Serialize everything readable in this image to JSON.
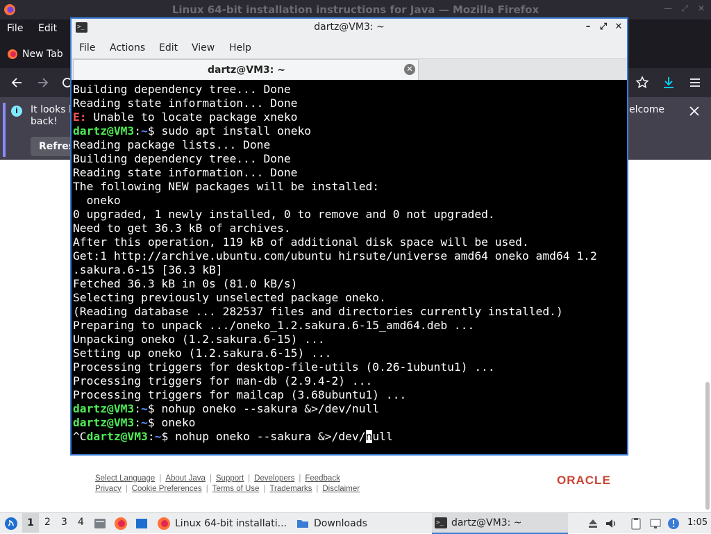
{
  "firefox": {
    "window_title": "Linux 64-bit installation instructions for Java — Mozilla Firefox",
    "menu": [
      "File",
      "Edit"
    ],
    "tab_label": "New Tab",
    "notification": {
      "text_left": "It looks l",
      "text_left2": "back!",
      "text_right": "elcome",
      "button": "Refres"
    }
  },
  "footer": {
    "row1": [
      "Select Language",
      "About Java",
      "Support",
      "Developers",
      "Feedback"
    ],
    "row2": [
      "Privacy",
      "Cookie Preferences",
      "Terms of Use",
      "Trademarks",
      "Disclaimer"
    ],
    "brand": "ORACLE"
  },
  "terminal": {
    "window_title": "dartz@VM3: ~",
    "menu": [
      "File",
      "Actions",
      "Edit",
      "View",
      "Help"
    ],
    "tab_label": "dartz@VM3: ~",
    "lines": [
      [
        {
          "t": "Building dependency tree... Done"
        }
      ],
      [
        {
          "t": "Reading state information... Done"
        }
      ],
      [
        {
          "t": "E:",
          "c": "pe"
        },
        {
          "t": " Unable to locate package xneko"
        }
      ],
      [
        {
          "t": "dartz@VM3",
          "c": "pg"
        },
        {
          "t": ":"
        },
        {
          "t": "~",
          "c": "pb"
        },
        {
          "t": "$ sudo apt install oneko"
        }
      ],
      [
        {
          "t": "Reading package lists... Done"
        }
      ],
      [
        {
          "t": "Building dependency tree... Done"
        }
      ],
      [
        {
          "t": "Reading state information... Done"
        }
      ],
      [
        {
          "t": "The following NEW packages will be installed:"
        }
      ],
      [
        {
          "t": "  oneko"
        }
      ],
      [
        {
          "t": "0 upgraded, 1 newly installed, 0 to remove and 0 not upgraded."
        }
      ],
      [
        {
          "t": "Need to get 36.3 kB of archives."
        }
      ],
      [
        {
          "t": "After this operation, 119 kB of additional disk space will be used."
        }
      ],
      [
        {
          "t": "Get:1 http://archive.ubuntu.com/ubuntu hirsute/universe amd64 oneko amd64 1.2"
        }
      ],
      [
        {
          "t": ".sakura.6-15 [36.3 kB]"
        }
      ],
      [
        {
          "t": "Fetched 36.3 kB in 0s (81.0 kB/s)"
        }
      ],
      [
        {
          "t": "Selecting previously unselected package oneko."
        }
      ],
      [
        {
          "t": "(Reading database ... 282537 files and directories currently installed.)"
        }
      ],
      [
        {
          "t": "Preparing to unpack .../oneko_1.2.sakura.6-15_amd64.deb ..."
        }
      ],
      [
        {
          "t": "Unpacking oneko (1.2.sakura.6-15) ..."
        }
      ],
      [
        {
          "t": "Setting up oneko (1.2.sakura.6-15) ..."
        }
      ],
      [
        {
          "t": "Processing triggers for desktop-file-utils (0.26-1ubuntu1) ..."
        }
      ],
      [
        {
          "t": "Processing triggers for man-db (2.9.4-2) ..."
        }
      ],
      [
        {
          "t": "Processing triggers for mailcap (3.68ubuntu1) ..."
        }
      ],
      [
        {
          "t": "dartz@VM3",
          "c": "pg"
        },
        {
          "t": ":"
        },
        {
          "t": "~",
          "c": "pb"
        },
        {
          "t": "$ nohup oneko --sakura &>/dev/null"
        }
      ],
      [
        {
          "t": "dartz@VM3",
          "c": "pg"
        },
        {
          "t": ":"
        },
        {
          "t": "~",
          "c": "pb"
        },
        {
          "t": "$ oneko"
        }
      ],
      [
        {
          "t": "^C"
        },
        {
          "t": "dartz@VM3",
          "c": "pg"
        },
        {
          "t": ":"
        },
        {
          "t": "~",
          "c": "pb"
        },
        {
          "t": "$ nohup oneko --sakura &>/dev/"
        },
        {
          "t": "n",
          "c": "cur"
        },
        {
          "t": "ull"
        }
      ]
    ]
  },
  "taskbar": {
    "workspaces": [
      "1",
      "2",
      "3",
      "4"
    ],
    "tasks": {
      "firefox": "Linux 64-bit installati...",
      "downloads": "Downloads",
      "terminal": "dartz@VM3: ~"
    },
    "clock": "1:05"
  }
}
